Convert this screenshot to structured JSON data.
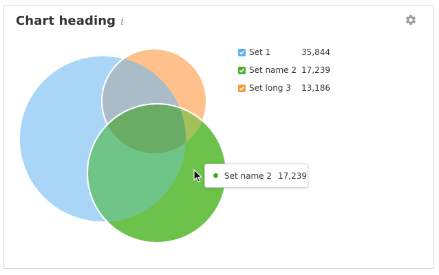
{
  "header": {
    "title": "Chart heading",
    "info_icon": "info-icon",
    "info_glyph": "i",
    "settings_icon": "gear-icon"
  },
  "chart_data": {
    "type": "venn",
    "title": "Chart heading",
    "sets": [
      {
        "name": "Set 1",
        "value": 35844,
        "value_label": "35,844",
        "color": "#a9d5f7",
        "checked": true,
        "checkbox_color": "#5aafec"
      },
      {
        "name": "Set name 2",
        "value": 17239,
        "value_label": "17,239",
        "color": "#6cc24a",
        "checked": true,
        "checkbox_color": "#4cb034"
      },
      {
        "name": "Set long 3",
        "value": 13186,
        "value_label": "13,186",
        "color": "#ffc08c",
        "checked": true,
        "checkbox_color": "#f59a3f"
      }
    ],
    "legend_position": "top-right",
    "highlighted_set": "Set name 2"
  },
  "tooltip": {
    "label": "Set name 2",
    "value": "17,239",
    "dot_color": "#3fa82a"
  },
  "cursor": "pointer-arrow-icon"
}
